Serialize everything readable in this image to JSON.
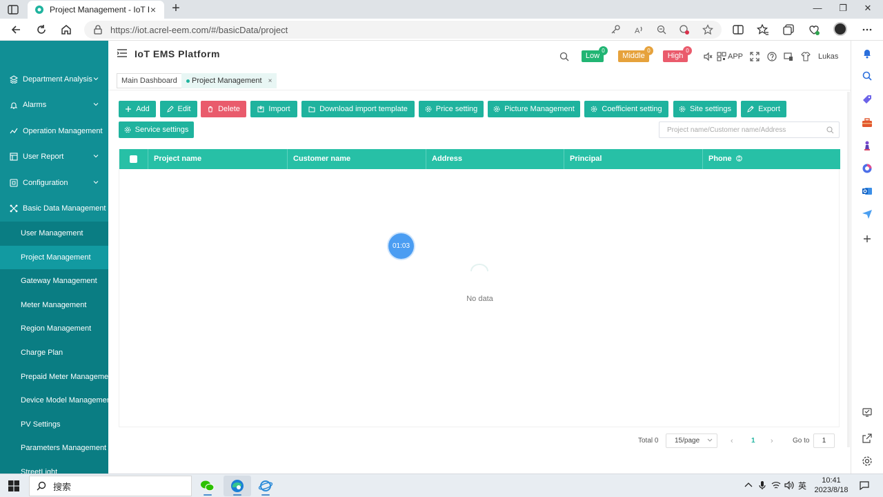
{
  "browser": {
    "tab_title": "Project Management - IoT EMS P",
    "url": "https://iot.acrel-eem.com/#/basicData/project"
  },
  "sidebar": {
    "items": [
      {
        "label": "Department Analysis",
        "icon": "layers-icon",
        "expandable": true
      },
      {
        "label": "Alarms",
        "icon": "alarm-icon",
        "expandable": true
      },
      {
        "label": "Operation Management",
        "icon": "operation-icon",
        "expandable": false
      },
      {
        "label": "User Report",
        "icon": "report-icon",
        "expandable": true
      },
      {
        "label": "Configuration",
        "icon": "config-icon",
        "expandable": true
      },
      {
        "label": "Basic Data Management",
        "icon": "basic-data-icon",
        "expandable": false
      }
    ],
    "sub_items": [
      {
        "label": "User Management",
        "active": false
      },
      {
        "label": "Project Management",
        "active": true
      },
      {
        "label": "Gateway Management",
        "active": false
      },
      {
        "label": "Meter Management",
        "active": false
      },
      {
        "label": "Region Management",
        "active": false
      },
      {
        "label": "Charge Plan",
        "active": false
      },
      {
        "label": "Prepaid Meter Management",
        "active": false
      },
      {
        "label": "Device Model Management",
        "active": false
      },
      {
        "label": "PV Settings",
        "active": false
      },
      {
        "label": "Parameters Management",
        "active": false
      },
      {
        "label": "StreetLight",
        "active": false
      }
    ]
  },
  "header": {
    "title": "IoT EMS Platform",
    "alarm_low": {
      "label": "Low",
      "count": "0",
      "color": "#21b573"
    },
    "alarm_middle": {
      "label": "Middle",
      "count": "0",
      "color": "#e6a23c"
    },
    "alarm_high": {
      "label": "High",
      "count": "0",
      "color": "#ea5b6c"
    },
    "app_label": "APP",
    "user": "Lukas"
  },
  "tags": {
    "main": "Main Dashboard",
    "current": "Project Management",
    "close": "×"
  },
  "toolbar": {
    "buttons": [
      {
        "label": "Add",
        "icon": "plus-icon"
      },
      {
        "label": "Edit",
        "icon": "pencil-icon"
      },
      {
        "label": "Delete",
        "icon": "trash-icon"
      },
      {
        "label": "Import",
        "icon": "import-icon"
      },
      {
        "label": "Download import template",
        "icon": "folder-icon"
      },
      {
        "label": "Price setting",
        "icon": "gear-icon"
      },
      {
        "label": "Picture Management",
        "icon": "gear-icon"
      },
      {
        "label": "Coefficient setting",
        "icon": "gear-icon"
      },
      {
        "label": "Site settings",
        "icon": "gear-icon"
      },
      {
        "label": "Export",
        "icon": "export-icon"
      },
      {
        "label": "Service settings",
        "icon": "gear-icon"
      }
    ],
    "search_placeholder": "Project name/Customer name/Address"
  },
  "table": {
    "columns": [
      "Project name",
      "Customer name",
      "Address",
      "Principal",
      "Phone"
    ],
    "empty_text": "No data"
  },
  "timer": "01:03",
  "pagination": {
    "total": "Total 0",
    "page_size": "15/page",
    "current_page": "1",
    "goto_label": "Go to",
    "goto_value": "1"
  },
  "taskbar": {
    "search_text": "搜索",
    "ime": "英",
    "time": "10:41",
    "date": "2023/8/18"
  },
  "colors": {
    "sidebar": "#118f95",
    "accent": "#1fb39e",
    "table_header": "#27c0a6",
    "danger": "#e95b6c"
  }
}
